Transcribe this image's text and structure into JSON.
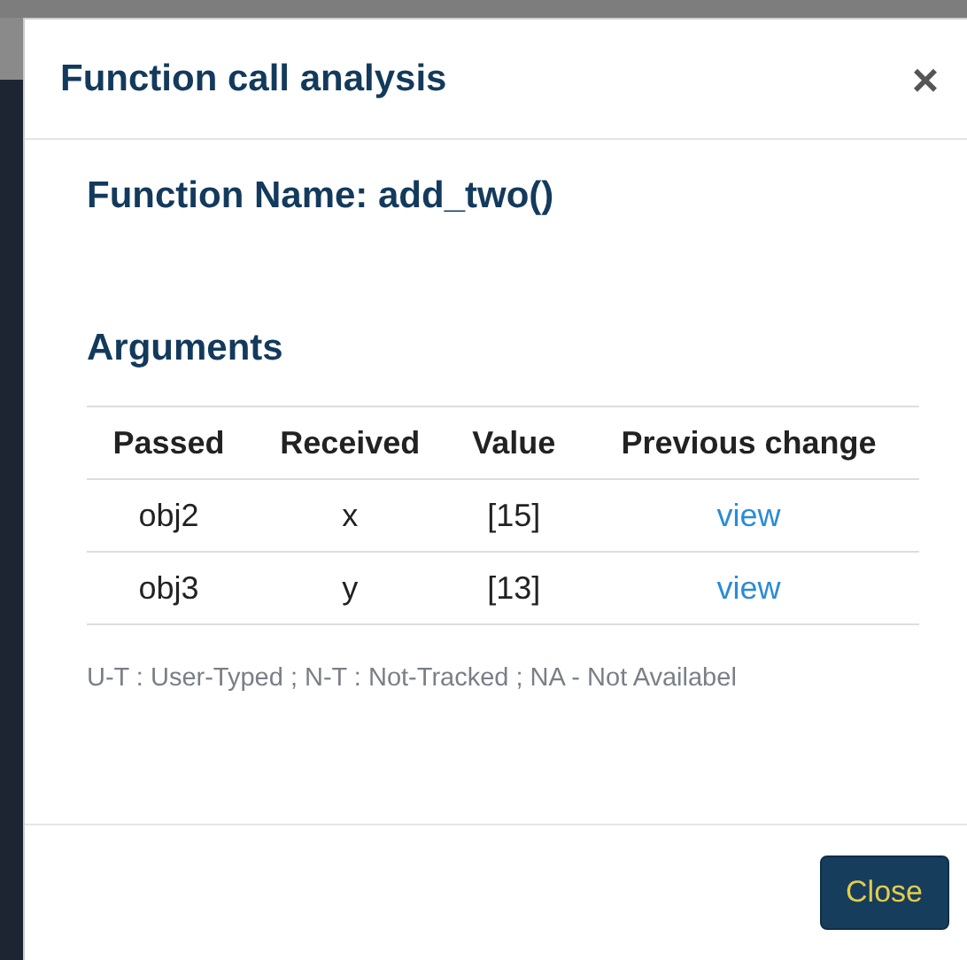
{
  "dialog": {
    "title": "Function call analysis",
    "close_glyph": "×"
  },
  "function_name": "Function Name: add_two()",
  "arguments": {
    "heading": "Arguments",
    "columns": [
      "Passed",
      "Received",
      "Value",
      "Previous change"
    ],
    "rows": [
      {
        "passed": "obj2",
        "received": "x",
        "value": "[15]",
        "link": "view"
      },
      {
        "passed": "obj3",
        "received": "y",
        "value": "[13]",
        "link": "view"
      }
    ]
  },
  "legend": "U-T : User-Typed ; N-T : Not-Tracked ; NA - Not Availabel",
  "footer_button": "Close"
}
